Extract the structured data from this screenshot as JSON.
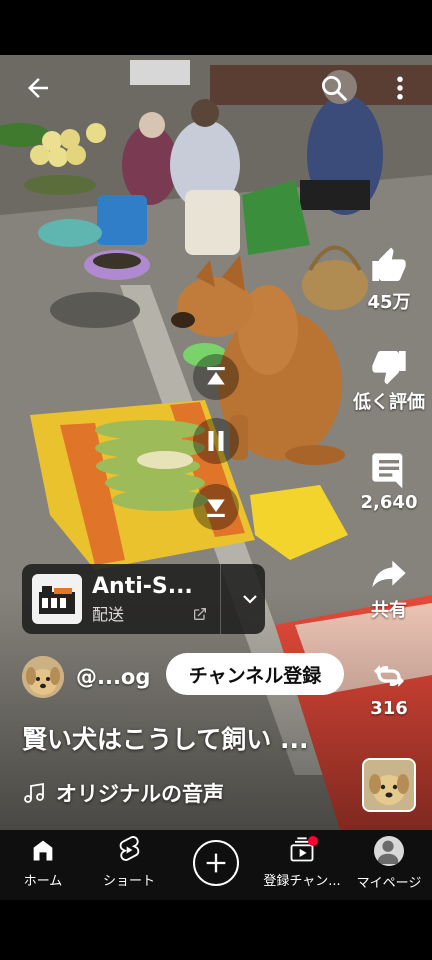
{
  "video": {
    "actions": {
      "like_count": "45万",
      "dislike_label": "低く評価",
      "comment_count": "2,640",
      "share_label": "共有",
      "remix_count": "316"
    },
    "music_card": {
      "title": "Anti-S...",
      "subtitle": "配送"
    },
    "channel": {
      "handle": "@...og",
      "subscribe_label": "チャンネル登録"
    },
    "title": "賢い犬はこうして飼い ...",
    "audio_label": "オリジナルの音声"
  },
  "navbar": {
    "home": "ホーム",
    "shorts": "ショート",
    "subscriptions": "登録チャン...",
    "you": "マイページ"
  },
  "colors": {
    "subscribe_bg": "#ffffff",
    "notification_dot": "#ff0033",
    "navbar_bg": "#0f0f0f"
  }
}
